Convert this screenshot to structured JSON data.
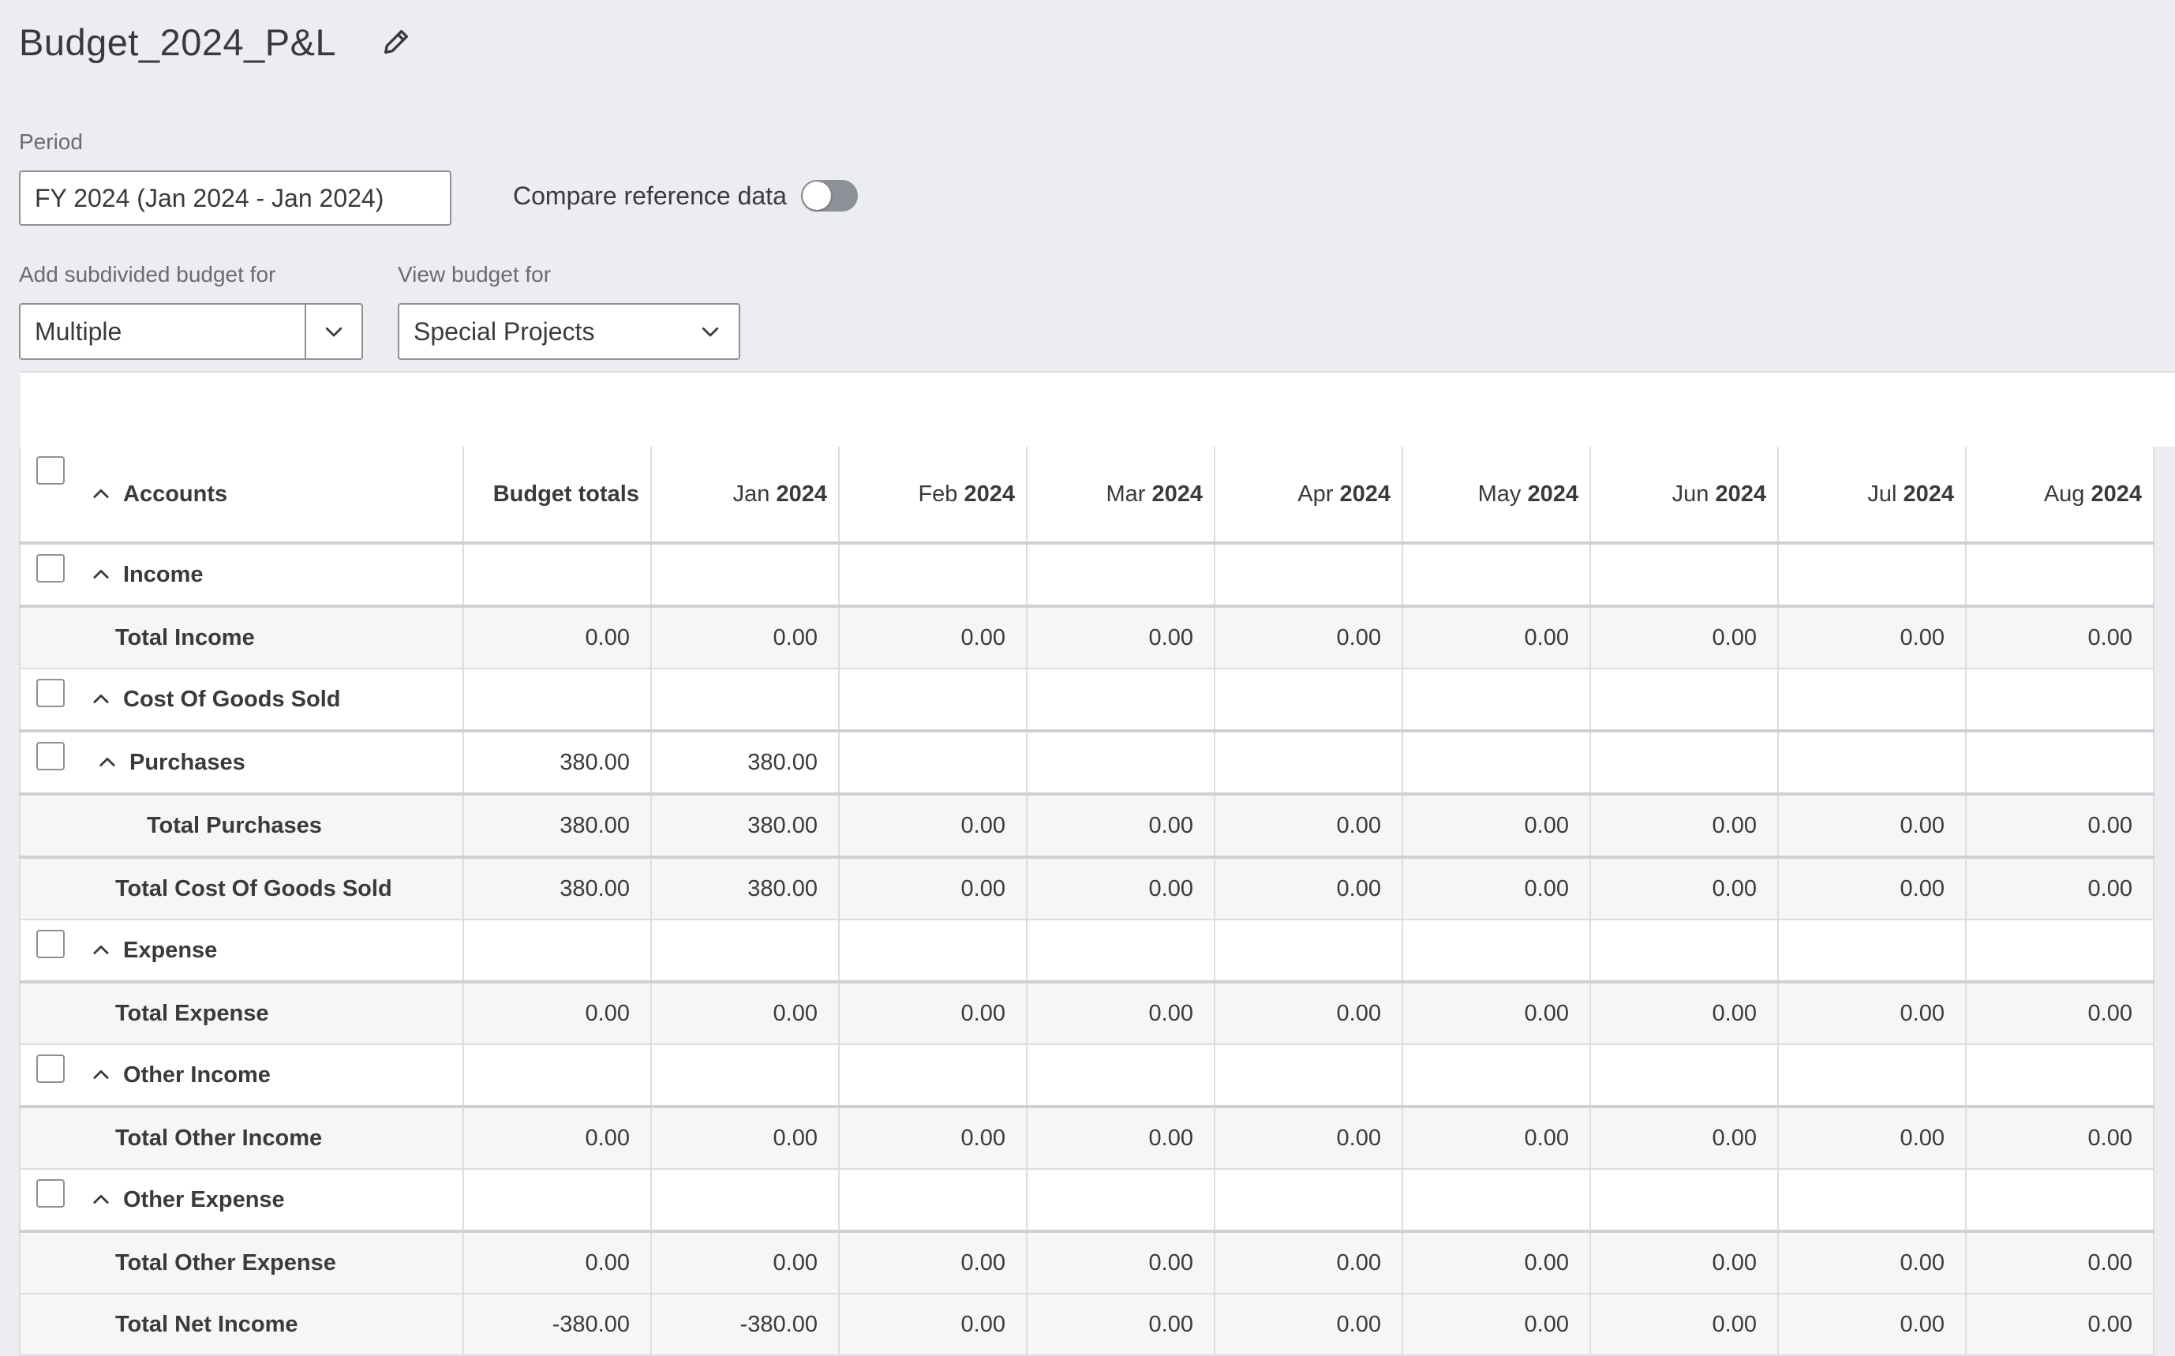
{
  "page": {
    "title": "Budget_2024_P&L"
  },
  "period": {
    "label": "Period",
    "value": "FY 2024 (Jan 2024 - Jan 2024)"
  },
  "compare": {
    "label": "Compare reference data",
    "enabled": false
  },
  "subdivided": {
    "label": "Add subdivided budget for",
    "value": "Multiple"
  },
  "view_budget": {
    "label": "View budget for",
    "value": "Special Projects"
  },
  "table": {
    "accounts_header": "Accounts",
    "totals_header": "Budget totals",
    "months": [
      {
        "m": "Jan",
        "y": "2024"
      },
      {
        "m": "Feb",
        "y": "2024"
      },
      {
        "m": "Mar",
        "y": "2024"
      },
      {
        "m": "Apr",
        "y": "2024"
      },
      {
        "m": "May",
        "y": "2024"
      },
      {
        "m": "Jun",
        "y": "2024"
      },
      {
        "m": "Jul",
        "y": "2024"
      },
      {
        "m": "Aug",
        "y": "2024"
      }
    ],
    "rows": [
      {
        "kind": "section",
        "label": "Income",
        "values": [
          "",
          "",
          "",
          "",
          "",
          "",
          "",
          "",
          ""
        ]
      },
      {
        "kind": "total",
        "label": "Total Income",
        "values": [
          "0.00",
          "0.00",
          "0.00",
          "0.00",
          "0.00",
          "0.00",
          "0.00",
          "0.00",
          "0.00"
        ]
      },
      {
        "kind": "section",
        "label": "Cost Of Goods Sold",
        "values": [
          "",
          "",
          "",
          "",
          "",
          "",
          "",
          "",
          ""
        ]
      },
      {
        "kind": "subsection",
        "label": "Purchases",
        "values": [
          "380.00",
          "380.00",
          "",
          "",
          "",
          "",
          "",
          "",
          ""
        ]
      },
      {
        "kind": "subtotal",
        "label": "Total Purchases",
        "values": [
          "380.00",
          "380.00",
          "0.00",
          "0.00",
          "0.00",
          "0.00",
          "0.00",
          "0.00",
          "0.00"
        ]
      },
      {
        "kind": "total",
        "label": "Total Cost Of Goods Sold",
        "values": [
          "380.00",
          "380.00",
          "0.00",
          "0.00",
          "0.00",
          "0.00",
          "0.00",
          "0.00",
          "0.00"
        ]
      },
      {
        "kind": "section",
        "label": "Expense",
        "values": [
          "",
          "",
          "",
          "",
          "",
          "",
          "",
          "",
          ""
        ]
      },
      {
        "kind": "total",
        "label": "Total Expense",
        "values": [
          "0.00",
          "0.00",
          "0.00",
          "0.00",
          "0.00",
          "0.00",
          "0.00",
          "0.00",
          "0.00"
        ]
      },
      {
        "kind": "section",
        "label": "Other Income",
        "values": [
          "",
          "",
          "",
          "",
          "",
          "",
          "",
          "",
          ""
        ]
      },
      {
        "kind": "total",
        "label": "Total Other Income",
        "values": [
          "0.00",
          "0.00",
          "0.00",
          "0.00",
          "0.00",
          "0.00",
          "0.00",
          "0.00",
          "0.00"
        ]
      },
      {
        "kind": "section",
        "label": "Other Expense",
        "values": [
          "",
          "",
          "",
          "",
          "",
          "",
          "",
          "",
          ""
        ]
      },
      {
        "kind": "total",
        "label": "Total Other Expense",
        "values": [
          "0.00",
          "0.00",
          "0.00",
          "0.00",
          "0.00",
          "0.00",
          "0.00",
          "0.00",
          "0.00"
        ]
      },
      {
        "kind": "total",
        "label": "Total Net Income",
        "values": [
          "-380.00",
          "-380.00",
          "0.00",
          "0.00",
          "0.00",
          "0.00",
          "0.00",
          "0.00",
          "0.00"
        ]
      }
    ]
  },
  "icons": {
    "edit": "pencil-icon",
    "collapse": "chevron-up-icon",
    "dropdown": "chevron-down-icon"
  },
  "colors": {
    "background": "#ecedf1",
    "border": "#8d9096",
    "text": "#393a3d",
    "toggle_off": "#8d9096"
  }
}
